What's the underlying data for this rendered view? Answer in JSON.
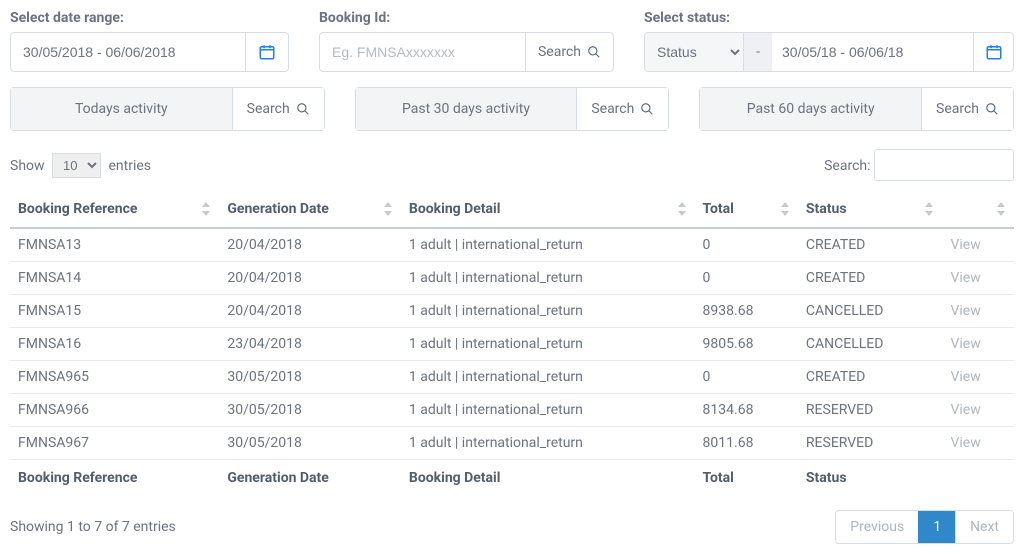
{
  "filters": {
    "dateRange": {
      "label": "Select date range:",
      "value": "30/05/2018 - 06/06/2018"
    },
    "bookingId": {
      "label": "Booking Id:",
      "placeholder": "Eg. FMNSAxxxxxxx",
      "searchLabel": "Search"
    },
    "status": {
      "label": "Select status:",
      "selectLabel": "Status",
      "dash": "-",
      "dateValue": "30/05/18 - 06/06/18"
    }
  },
  "quick": [
    {
      "label": "Todays activity",
      "search": "Search"
    },
    {
      "label": "Past 30 days activity",
      "search": "Search"
    },
    {
      "label": "Past 60 days activity",
      "search": "Search"
    }
  ],
  "tableControls": {
    "showPrefix": "Show",
    "showSuffix": "entries",
    "pageSize": "10",
    "searchLabel": "Search:"
  },
  "columns": [
    "Booking Reference",
    "Generation Date",
    "Booking Detail",
    "Total",
    "Status",
    ""
  ],
  "rows": [
    {
      "ref": "FMNSA13",
      "date": "20/04/2018",
      "detail": "1 adult | international_return",
      "total": "0",
      "status": "CREATED",
      "action": "View"
    },
    {
      "ref": "FMNSA14",
      "date": "20/04/2018",
      "detail": "1 adult | international_return",
      "total": "0",
      "status": "CREATED",
      "action": "View"
    },
    {
      "ref": "FMNSA15",
      "date": "20/04/2018",
      "detail": "1 adult | international_return",
      "total": "8938.68",
      "status": "CANCELLED",
      "action": "View"
    },
    {
      "ref": "FMNSA16",
      "date": "23/04/2018",
      "detail": "1 adult | international_return",
      "total": "9805.68",
      "status": "CANCELLED",
      "action": "View"
    },
    {
      "ref": "FMNSA965",
      "date": "30/05/2018",
      "detail": "1 adult | international_return",
      "total": "0",
      "status": "CREATED",
      "action": "View"
    },
    {
      "ref": "FMNSA966",
      "date": "30/05/2018",
      "detail": "1 adult | international_return",
      "total": "8134.68",
      "status": "RESERVED",
      "action": "View"
    },
    {
      "ref": "FMNSA967",
      "date": "30/05/2018",
      "detail": "1 adult | international_return",
      "total": "8011.68",
      "status": "RESERVED",
      "action": "View"
    }
  ],
  "footer": {
    "info": "Showing 1 to 7 of 7 entries",
    "prev": "Previous",
    "page": "1",
    "next": "Next"
  }
}
